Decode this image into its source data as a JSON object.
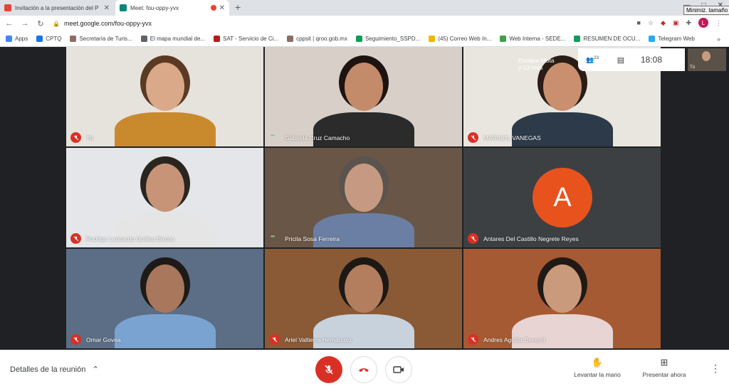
{
  "browser": {
    "tabs": [
      {
        "title": "Invitación a la presentación del P",
        "favicon_color": "#ea4335",
        "active": false
      },
      {
        "title": "Meet: fou-oppy-yvx",
        "favicon_color": "#00897b",
        "active": true
      }
    ],
    "new_tab": "+",
    "url": "meet.google.com/fou-oppy-yvx",
    "tooltip": "Minimiz. tamaño",
    "profile_initial": "L",
    "bookmarks": [
      {
        "label": "Apps",
        "color": "#4285f4"
      },
      {
        "label": "CPTQ",
        "color": "#1a73e8"
      },
      {
        "label": "Secretaría de Turis...",
        "color": "#8d6e63"
      },
      {
        "label": "El mapa mundial de...",
        "color": "#5f6368"
      },
      {
        "label": "SAT - Servicio de Ci...",
        "color": "#b71c1c"
      },
      {
        "label": "cppsit | qroo.gob.mx",
        "color": "#8d6e63"
      },
      {
        "label": "Seguimiento_SSPD...",
        "color": "#0f9d58"
      },
      {
        "label": "(45) Correo Web In...",
        "color": "#f4b400"
      },
      {
        "label": "Web Interna - SEDE...",
        "color": "#43a047"
      },
      {
        "label": "RESUMEN DE OCU...",
        "color": "#0f9d58"
      },
      {
        "label": "Telegram Web",
        "color": "#2aabee"
      }
    ],
    "bookmarks_more": "»"
  },
  "meeting": {
    "presenter_label": "Enrique Mota\ny 13 más",
    "participant_count": "23",
    "time": "18:08",
    "self_label": "Tú",
    "tiles": [
      {
        "name": "Tú",
        "muted": true,
        "speaking": false,
        "bg": "#e6e2dc",
        "skin": "#d9a98a",
        "shirt": "#c98a2e",
        "hair": "#5a3a22"
      },
      {
        "name": "Gabriela Cruz Camacho",
        "muted": false,
        "speaking": true,
        "bg": "#d8cfc8",
        "skin": "#c48b6a",
        "shirt": "#2b2b2b",
        "hair": "#1d1412"
      },
      {
        "name": "MARISOL VANEGAS",
        "muted": true,
        "speaking": false,
        "bg": "#e9e6df",
        "skin": "#c98f6f",
        "shirt": "#2d3a4a",
        "hair": "#2a1c16"
      },
      {
        "name": "Rodrigo Leonardo Guillen Breton",
        "muted": true,
        "speaking": false,
        "bg": "#e4e6e9",
        "skin": "#c89478",
        "shirt": "#e5e5e5",
        "hair": "#2b2520"
      },
      {
        "name": "Pricila Sosa Ferreira",
        "muted": false,
        "speaking": true,
        "bg": "#6a5646",
        "skin": "#c69a82",
        "shirt": "#6a7fa3",
        "hair": "#5b534e"
      },
      {
        "name": "Antares Del Castillo Negrete Reyes",
        "muted": true,
        "speaking": false,
        "avatar": "A",
        "bg": "#3c4043"
      },
      {
        "name": "Omar Govea",
        "muted": true,
        "speaking": false,
        "bg": "#5b6e85",
        "skin": "#a8775c",
        "shirt": "#7aa3d1",
        "hair": "#1e1a18"
      },
      {
        "name": "Ariel Valtierra Hernández",
        "muted": true,
        "speaking": false,
        "bg": "#8a5a36",
        "skin": "#b27e5e",
        "shirt": "#c8d2dd",
        "hair": "#1c1815"
      },
      {
        "name": "Andres Aguilar Becerril",
        "muted": true,
        "speaking": false,
        "bg": "#a65a33",
        "skin": "#c99a7c",
        "shirt": "#e7d4d3",
        "hair": "#201a16"
      }
    ]
  },
  "bottom_bar": {
    "details_label": "Detalles de la reunión",
    "raise_hand_label": "Levantar la mano",
    "present_label": "Presentar ahora"
  },
  "colors": {
    "mute_red": "#d93025",
    "avatar_orange": "#e8531d"
  }
}
